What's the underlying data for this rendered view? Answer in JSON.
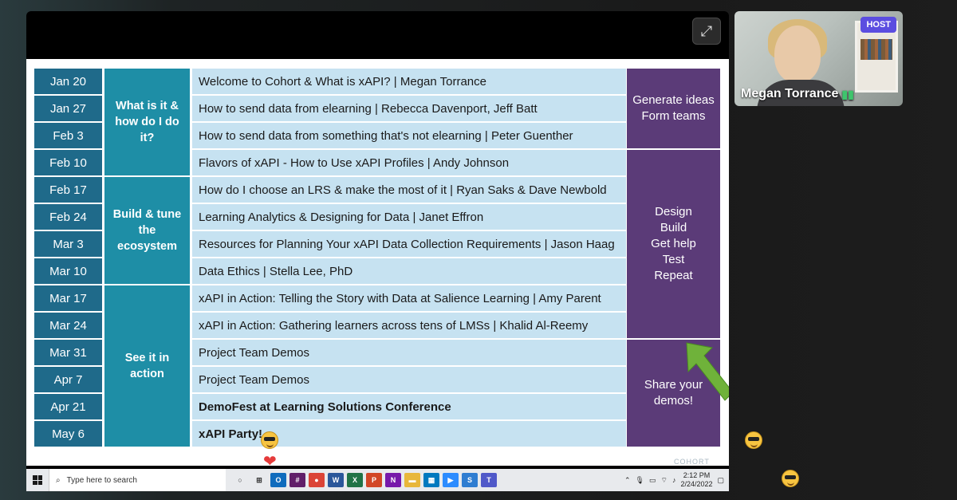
{
  "share": {
    "expand_icon": "expand-icon"
  },
  "schedule": {
    "dates": [
      "Jan 20",
      "Jan 27",
      "Feb 3",
      "Feb 10",
      "Feb 17",
      "Feb 24",
      "Mar 3",
      "Mar 10",
      "Mar 17",
      "Mar 24",
      "Mar 31",
      "Apr 7",
      "Apr 21",
      "May 6"
    ],
    "topics": [
      {
        "label": "What is it & how do I do it?"
      },
      {
        "label": "Build & tune the ecosystem"
      },
      {
        "label": "See it in action"
      }
    ],
    "sessions": [
      {
        "text": "Welcome to Cohort & What is xAPI? | Megan Torrance",
        "bold": false
      },
      {
        "text": "How to send data from elearning | Rebecca Davenport, Jeff Batt",
        "bold": false
      },
      {
        "text": "How to send data from something that's not elearning | Peter Guenther",
        "bold": false
      },
      {
        "text": "Flavors of xAPI - How to Use xAPI Profiles | Andy Johnson",
        "bold": false
      },
      {
        "text": "How do I choose an LRS & make the most of it | Ryan Saks & Dave Newbold",
        "bold": false
      },
      {
        "text": "Learning Analytics & Designing for Data | Janet Effron",
        "bold": false
      },
      {
        "text": "Resources for Planning Your xAPI Data Collection Requirements | Jason Haag",
        "bold": false
      },
      {
        "text": "Data Ethics | Stella Lee, PhD",
        "bold": false
      },
      {
        "text": "xAPI in Action: Telling the Story with Data at Salience Learning | Amy Parent",
        "bold": false
      },
      {
        "text": "xAPI in Action: Gathering learners across tens of LMSs | Khalid Al-Reemy",
        "bold": false
      },
      {
        "text": "Project Team Demos",
        "bold": false
      },
      {
        "text": "Project Team Demos",
        "bold": false
      },
      {
        "text": "DemoFest at Learning Solutions Conference",
        "bold": true
      },
      {
        "text": "xAPI Party!",
        "bold": true
      }
    ],
    "phases": [
      {
        "lines": [
          "Generate ideas",
          "Form teams"
        ]
      },
      {
        "lines": [
          "Design",
          "Build",
          "Get help",
          "Test",
          "Repeat"
        ]
      },
      {
        "lines": [
          "Share your",
          "demos!"
        ]
      }
    ],
    "watermark": "COHORT"
  },
  "taskbar": {
    "search_placeholder": "Type here to search",
    "time": "2:12 PM",
    "date": "2/24/2022",
    "apps": [
      {
        "icon": "outlook-icon",
        "glyph": "O",
        "color": "#0f6cbd"
      },
      {
        "icon": "slack-icon",
        "glyph": "#",
        "color": "#611f69"
      },
      {
        "icon": "chrome-icon",
        "glyph": "●",
        "color": "#db4437"
      },
      {
        "icon": "word-icon",
        "glyph": "W",
        "color": "#2b579a"
      },
      {
        "icon": "excel-icon",
        "glyph": "X",
        "color": "#217346"
      },
      {
        "icon": "powerpoint-icon",
        "glyph": "P",
        "color": "#d24726"
      },
      {
        "icon": "onenote-icon",
        "glyph": "N",
        "color": "#7719aa"
      },
      {
        "icon": "file-explorer-icon",
        "glyph": "▬",
        "color": "#e8b73b"
      },
      {
        "icon": "trello-icon",
        "glyph": "▦",
        "color": "#0079bf"
      },
      {
        "icon": "zoom-icon",
        "glyph": "▶",
        "color": "#2d8cff"
      },
      {
        "icon": "snagit-icon",
        "glyph": "S",
        "color": "#2f7dd1"
      },
      {
        "icon": "teams-icon",
        "glyph": "T",
        "color": "#5059c9"
      }
    ]
  },
  "video": {
    "host_label": "HOST",
    "participant_name": "Megan Torrance"
  }
}
